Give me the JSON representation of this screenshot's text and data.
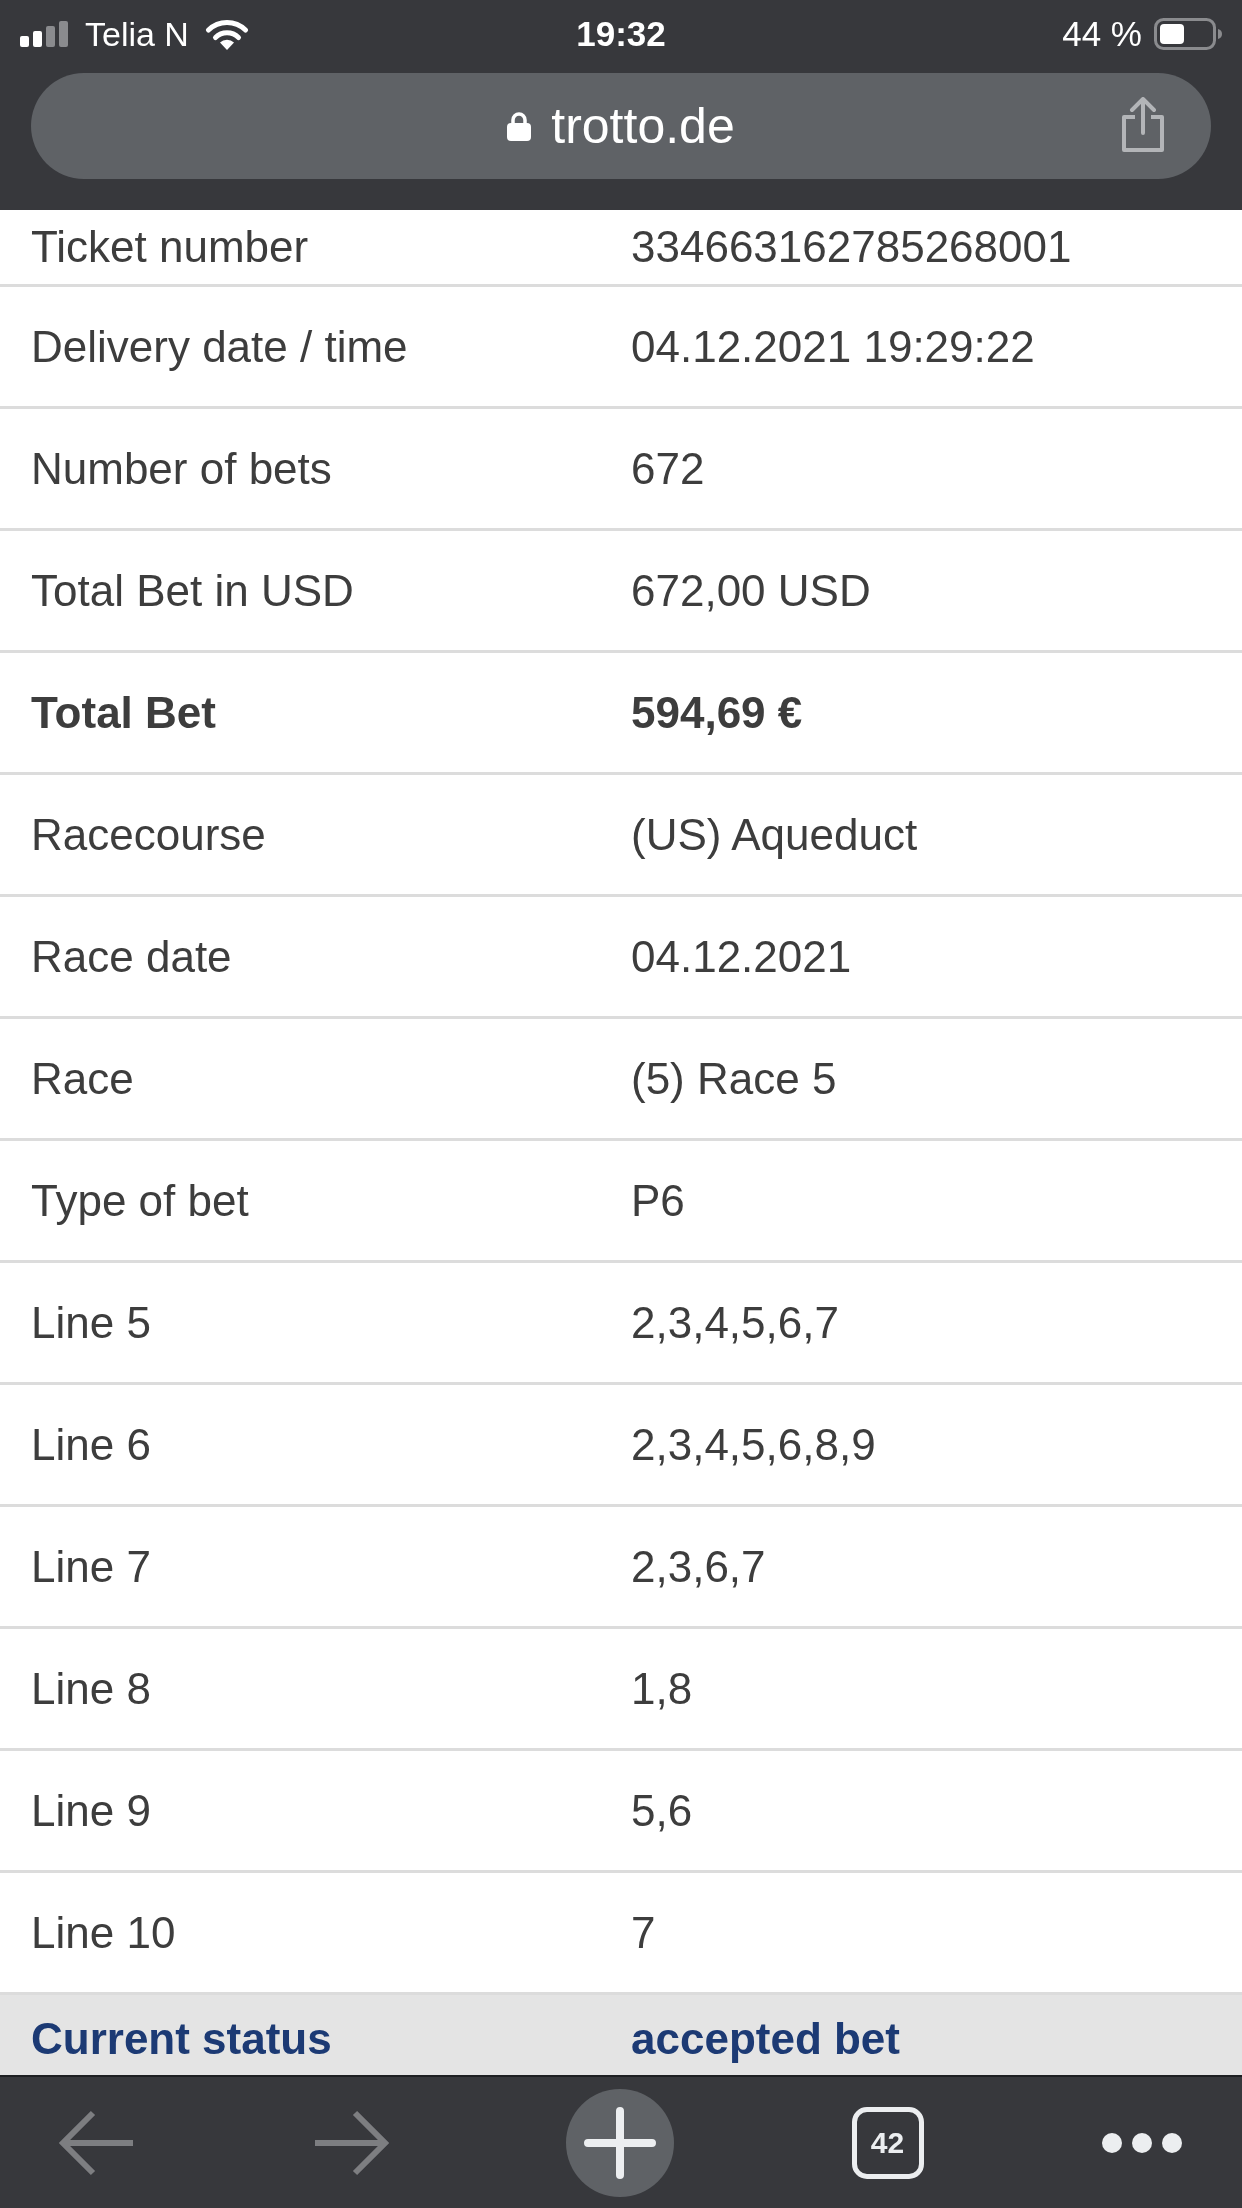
{
  "status_bar": {
    "carrier": "Telia N",
    "time": "19:32",
    "battery": "44 %"
  },
  "address_bar": {
    "url": "trotto.de"
  },
  "ticket_details": {
    "rows": [
      {
        "label": "Ticket number",
        "value": "334663162785268001",
        "kind": "plain"
      },
      {
        "label": "Delivery date / time",
        "value": "04.12.2021 19:29:22",
        "kind": "plain"
      },
      {
        "label": "Number of bets",
        "value": "672",
        "kind": "plain"
      },
      {
        "label": "Total Bet in USD",
        "value": "672,00 USD",
        "kind": "plain"
      },
      {
        "label": "Total Bet",
        "value": "594,69 €",
        "kind": "bold"
      },
      {
        "label": "Racecourse",
        "value": "(US) Aqueduct",
        "kind": "plain"
      },
      {
        "label": "Race date",
        "value": "04.12.2021",
        "kind": "plain"
      },
      {
        "label": "Race",
        "value": "(5) Race 5",
        "kind": "plain"
      },
      {
        "label": "Type of bet",
        "value": "P6",
        "kind": "plain"
      },
      {
        "label": "Line 5",
        "value": "2,3,4,5,6,7",
        "kind": "plain"
      },
      {
        "label": "Line 6",
        "value": "2,3,4,5,6,8,9",
        "kind": "plain"
      },
      {
        "label": "Line 7",
        "value": "2,3,6,7",
        "kind": "plain"
      },
      {
        "label": "Line 8",
        "value": "1,8",
        "kind": "plain"
      },
      {
        "label": "Line 9",
        "value": "5,6",
        "kind": "plain"
      },
      {
        "label": "Line 10",
        "value": "7",
        "kind": "plain"
      },
      {
        "label": "Current status",
        "value": "accepted bet",
        "kind": "status"
      }
    ]
  },
  "toolbar": {
    "back": {
      "disabled": true
    },
    "forward": {
      "disabled": true
    },
    "tab_count": "42"
  }
}
